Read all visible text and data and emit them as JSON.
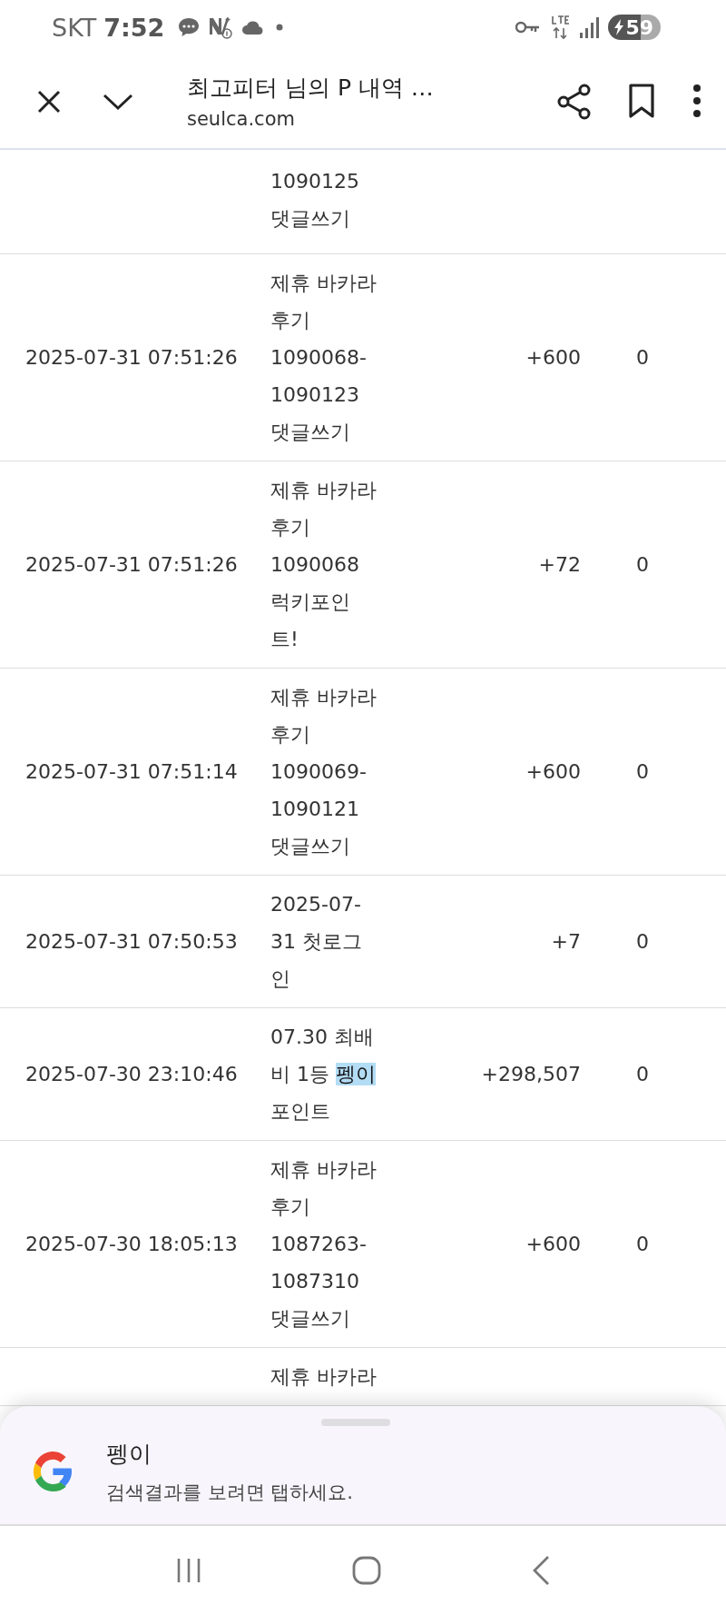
{
  "status_bar": {
    "carrier": "SKT",
    "time": "7:52",
    "battery": "59"
  },
  "toolbar": {
    "title": "최고피터 님의 P 내역 …",
    "url": "seulca.com"
  },
  "rows": [
    {
      "kind": "clipped_top",
      "lines": [
        "1090125",
        "댓글쓰기"
      ]
    },
    {
      "kind": "full",
      "date": "2025-07-31 07:51:26",
      "lines": [
        "제휴 바카라",
        "후기",
        "1090068-",
        "1090123",
        "댓글쓰기"
      ],
      "amount": "+600",
      "balance": "0"
    },
    {
      "kind": "full",
      "date": "2025-07-31 07:51:26",
      "lines": [
        "제휴 바카라",
        "후기",
        "1090068",
        "럭키포인",
        "트!"
      ],
      "amount": "+72",
      "balance": "0"
    },
    {
      "kind": "full",
      "date": "2025-07-31 07:51:14",
      "lines": [
        "제휴 바카라",
        "후기",
        "1090069-",
        "1090121",
        "댓글쓰기"
      ],
      "amount": "+600",
      "balance": "0"
    },
    {
      "kind": "full",
      "date": "2025-07-31 07:50:53",
      "lines": [
        "2025-07-",
        "31 첫로그",
        "인"
      ],
      "amount": "+7",
      "balance": "0"
    },
    {
      "kind": "full",
      "date": "2025-07-30 23:10:46",
      "lines": [
        "07.30 최배",
        [
          {
            "text": "비 1등 ",
            "selected": false
          },
          {
            "text": "펭이",
            "selected": true
          }
        ],
        "포인트"
      ],
      "amount": "+298,507",
      "balance": "0"
    },
    {
      "kind": "full",
      "date": "2025-07-30 18:05:13",
      "lines": [
        "제휴 바카라",
        "후기",
        "1087263-",
        "1087310",
        "댓글쓰기"
      ],
      "amount": "+600",
      "balance": "0"
    },
    {
      "kind": "full",
      "lines": [
        "제휴 바카라"
      ]
    }
  ],
  "search_sheet": {
    "query": "펭이",
    "hint": "검색결과를 보려면 탭하세요."
  }
}
